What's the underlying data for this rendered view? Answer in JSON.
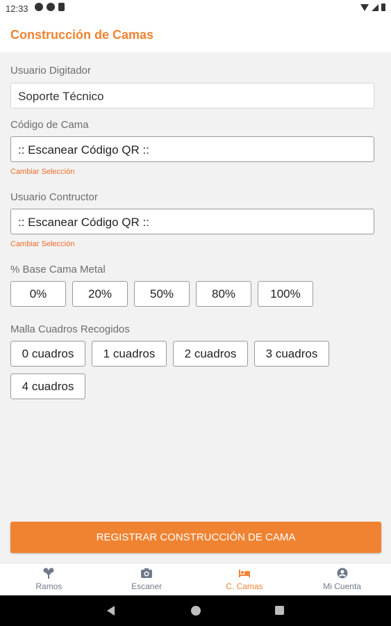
{
  "status_bar": {
    "time": "12:33"
  },
  "app_bar": {
    "title": "Construcción de Camas"
  },
  "form": {
    "usuario_digitador": {
      "label": "Usuario Digitador",
      "value": "Soporte Técnico"
    },
    "codigo_cama": {
      "label": "Código de Cama",
      "value": ":: Escanear Código QR ::",
      "change_link": "Cambiar Selección"
    },
    "usuario_constructor": {
      "label": "Usuario Contructor",
      "value": ":: Escanear Código QR ::",
      "change_link": "Cambiar Selección"
    },
    "base_cama_metal": {
      "label": "% Base Cama Metal",
      "options": [
        "0%",
        "20%",
        "50%",
        "80%",
        "100%"
      ]
    },
    "malla_cuadros": {
      "label": "Malla Cuadros Recogidos",
      "options": [
        "0 cuadros",
        "1 cuadros",
        "2 cuadros",
        "3 cuadros",
        "4 cuadros"
      ]
    }
  },
  "submit_label": "REGISTRAR CONSTRUCCIÓN DE CAMA",
  "bottom_nav": [
    {
      "label": "Ramos",
      "icon": "flower-icon",
      "active": false
    },
    {
      "label": "Escaner",
      "icon": "camera-icon",
      "active": false
    },
    {
      "label": "C. Camas",
      "icon": "bed-icon",
      "active": true
    },
    {
      "label": "Mi Cuenta",
      "icon": "account-icon",
      "active": false
    }
  ],
  "colors": {
    "accent": "#ef8332",
    "link": "#ef6b2a",
    "nav_inactive": "#707a8a"
  }
}
